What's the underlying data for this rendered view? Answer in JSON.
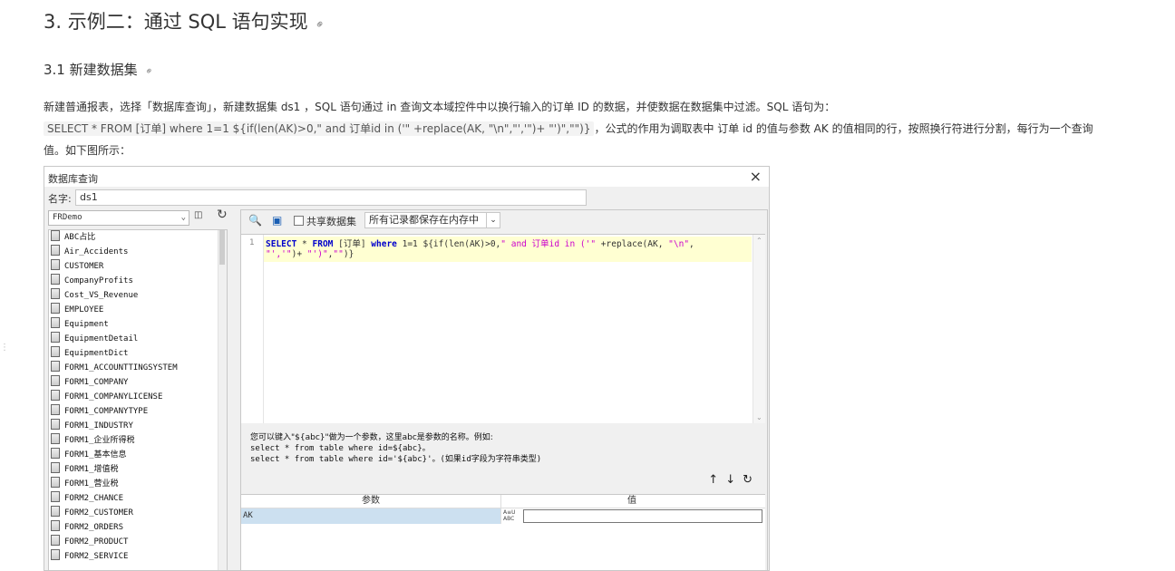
{
  "article": {
    "heading": "3. 示例二：通过 SQL 语句实现",
    "subheading": "3.1 新建数据集",
    "para1": "新建普通报表，选择「数据库查询」，新建数据集 ds1 ，SQL 语句通过 in 查询文本域控件中以换行输入的订单 ID 的数据，并使数据在数据集中过滤。SQL 语句为：",
    "code": "SELECT * FROM [订单] where 1=1  ${if(len(AK)>0,\" and 订单id in ('\" +replace(AK, \"\\n\",\"','\")+ \"')\",\"\")}",
    "para2_tail": "，公式的作用为调取表中 订单 id 的值与参数 AK 的值相同的行，按照换行符进行分割，每行为一个查询",
    "para3": "值。如下图所示："
  },
  "dialog": {
    "title": "数据库查询",
    "name_label": "名字:",
    "name_value": "ds1",
    "connection": "FRDemo",
    "tables": [
      "ABC占比",
      "Air_Accidents",
      "CUSTOMER",
      "CompanyProfits",
      "Cost_VS_Revenue",
      "EMPLOYEE",
      "Equipment",
      "EquipmentDetail",
      "EquipmentDict",
      "FORM1_ACCOUNTTINGSYSTEM",
      "FORM1_COMPANY",
      "FORM1_COMPANYLICENSE",
      "FORM1_COMPANYTYPE",
      "FORM1_INDUSTRY",
      "FORM1_企业所得税",
      "FORM1_基本信息",
      "FORM1_增值税",
      "FORM1_营业税",
      "FORM2_CHANCE",
      "FORM2_CUSTOMER",
      "FORM2_ORDERS",
      "FORM2_PRODUCT",
      "FORM2_SERVICE"
    ],
    "share_label": "共享数据集",
    "memory_option": "所有记录都保存在内存中",
    "line_no": "1",
    "hint_lines": [
      "您可以键入\"${abc}\"做为一个参数，这里abc是参数的名称。例如:",
      "select * from table where id=${abc}。",
      "select * from table where id='${abc}'。(如果id字段为字符串类型)"
    ],
    "param_header": "参数",
    "value_header": "值",
    "param_row": {
      "name": "AK",
      "value": ""
    }
  },
  "icons": {
    "link": "link-icon",
    "close": "close-icon"
  }
}
